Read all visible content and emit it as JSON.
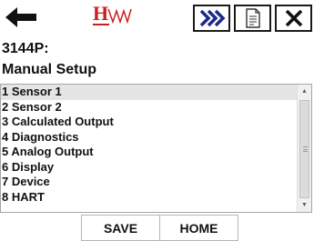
{
  "toolbar": {
    "back_icon": "back-arrow-icon",
    "logo_letter": "H",
    "send_icon": "double-chevron-right-icon",
    "document_icon": "document-icon",
    "close_icon": "close-icon"
  },
  "header": {
    "device_tag": "3144P:",
    "menu_title": "Manual Setup"
  },
  "menu": {
    "items": [
      {
        "label": "1 Sensor 1"
      },
      {
        "label": "2 Sensor 2"
      },
      {
        "label": "3 Calculated Output"
      },
      {
        "label": "4 Diagnostics"
      },
      {
        "label": "5 Analog Output"
      },
      {
        "label": "6 Display"
      },
      {
        "label": "7 Device"
      },
      {
        "label": "8 HART"
      }
    ],
    "selected_index": 0
  },
  "footer": {
    "save_label": "SAVE",
    "home_label": "HOME"
  },
  "colors": {
    "logo_red": "#cc1f1f",
    "send_blue": "#1b2a86",
    "selection_gray": "#e5e5e5"
  }
}
